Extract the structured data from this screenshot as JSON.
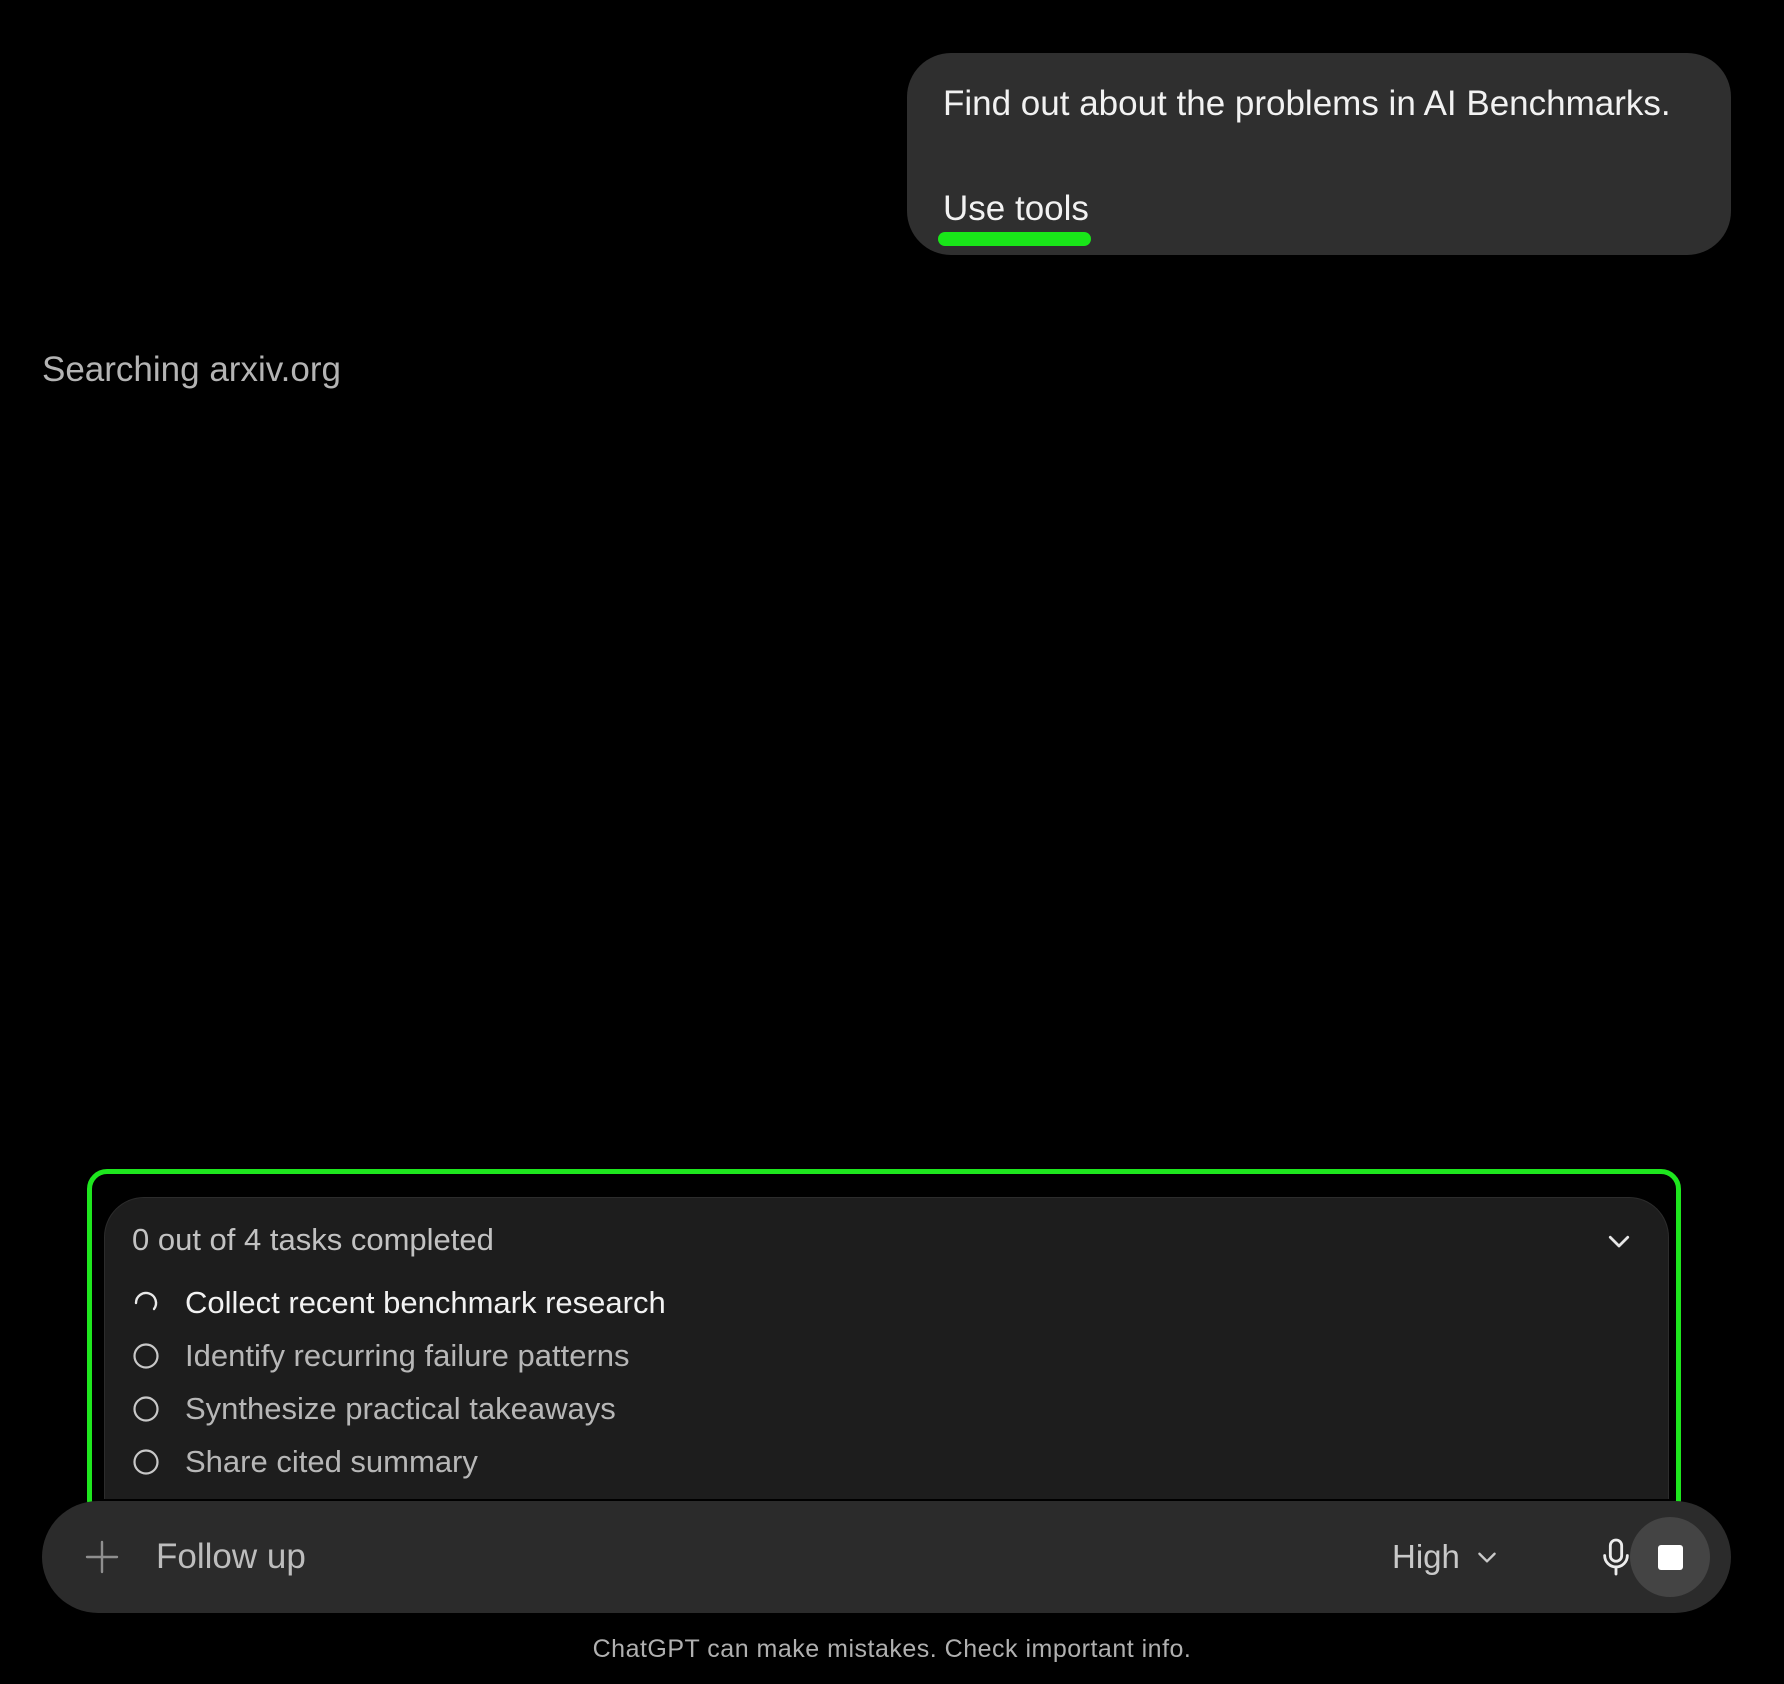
{
  "conversation": {
    "user_message": {
      "line1": "Find out about the problems in AI Benchmarks.",
      "line2": "Use tools"
    },
    "assistant_status": "Searching arxiv.org"
  },
  "highlight_color": "#1ee61e",
  "tasks": {
    "summary": "0 out of 4 tasks completed",
    "completed": 0,
    "total": 4,
    "items": [
      {
        "label": "Collect recent benchmark research",
        "state": "in-progress",
        "icon": "spinner-icon"
      },
      {
        "label": "Identify recurring failure patterns",
        "state": "pending",
        "icon": "circle-icon"
      },
      {
        "label": "Synthesize practical takeaways",
        "state": "pending",
        "icon": "circle-icon"
      },
      {
        "label": "Share cited summary",
        "state": "pending",
        "icon": "circle-icon"
      }
    ]
  },
  "composer": {
    "placeholder": "Follow up",
    "effort_label": "High",
    "icons": [
      "plus-icon",
      "chevron-down-icon",
      "microphone-icon",
      "stop-icon"
    ]
  },
  "footer": {
    "disclaimer": "ChatGPT can make mistakes. Check important info."
  }
}
